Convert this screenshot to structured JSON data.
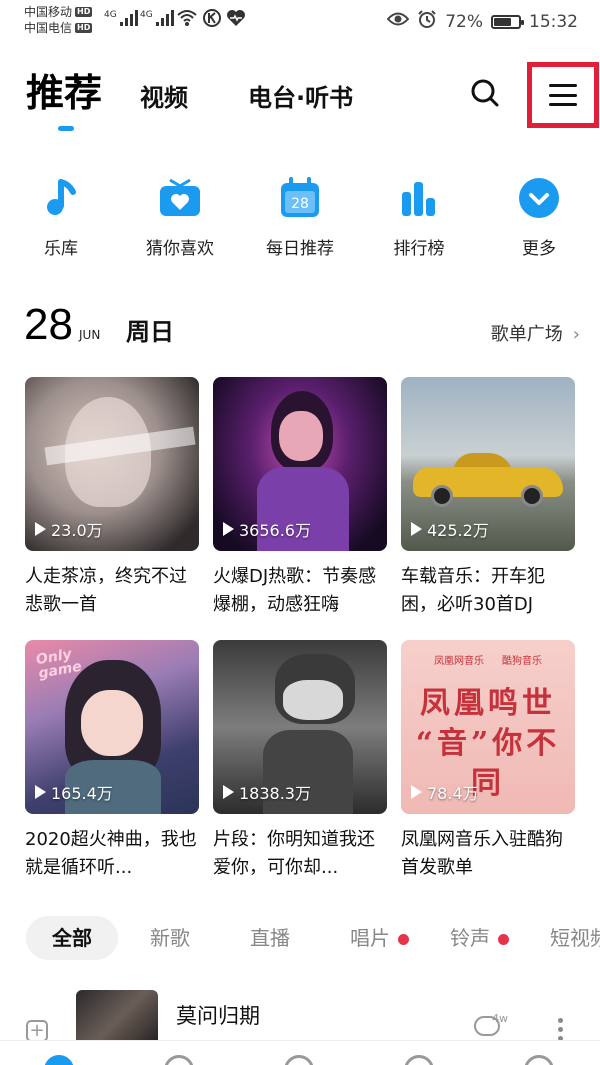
{
  "status_bar": {
    "carrier1": "中国移动",
    "carrier2": "中国电信",
    "hd": "HD",
    "net1": "4G",
    "net2": "4G",
    "k_icon": "k-circle-icon",
    "heart_icon": "heart-pulse-icon",
    "battery_percent": "72%",
    "battery_level": 0.72,
    "time": "15:32"
  },
  "top_tabs": {
    "recommend": "推荐",
    "video": "视频",
    "radio": "电台·听书"
  },
  "quick_nav": [
    {
      "label": "乐库",
      "icon": "music-note-icon"
    },
    {
      "label": "猜你喜欢",
      "icon": "radio-heart-icon"
    },
    {
      "label": "每日推荐",
      "icon": "calendar-icon",
      "icon_text": "28"
    },
    {
      "label": "排行榜",
      "icon": "bar-chart-icon"
    },
    {
      "label": "更多",
      "icon": "chevron-down-circle-icon"
    }
  ],
  "date_header": {
    "day": "28",
    "month": "JUN",
    "weekday": "周日",
    "more": "歌单广场"
  },
  "playlists": [
    {
      "plays": "23.0万",
      "title": "人走茶凉，终究不过悲歌一首"
    },
    {
      "plays": "3656.6万",
      "title": "火爆DJ热歌：节奏感爆棚，动感狂嗨"
    },
    {
      "plays": "425.2万",
      "title": "车载音乐：开车犯困，必听30首DJ"
    },
    {
      "plays": "165.4万",
      "title": "2020超火神曲，我也就是循环听...",
      "cover_text": "Only game"
    },
    {
      "plays": "1838.3万",
      "title": "片段：你明知道我还爱你，可你却..."
    },
    {
      "plays": "78.4万",
      "title": "凤凰网音乐入驻酷狗首发歌单",
      "cover_brand1": "凤凰网音乐",
      "cover_brand2": "酷狗音乐",
      "cover_line1": "凤凰鸣世",
      "cover_line2": "“音”你不同"
    }
  ],
  "filters": [
    {
      "label": "全部"
    },
    {
      "label": "新歌"
    },
    {
      "label": "直播"
    },
    {
      "label": "唱片"
    },
    {
      "label": "铃声"
    },
    {
      "label": "短视频"
    }
  ],
  "song": {
    "title": "莫问归期",
    "comments": "4w"
  },
  "colors": {
    "accent": "#1a9bf0",
    "highlight_border": "#e11f3b",
    "dot": "#e8344b"
  }
}
